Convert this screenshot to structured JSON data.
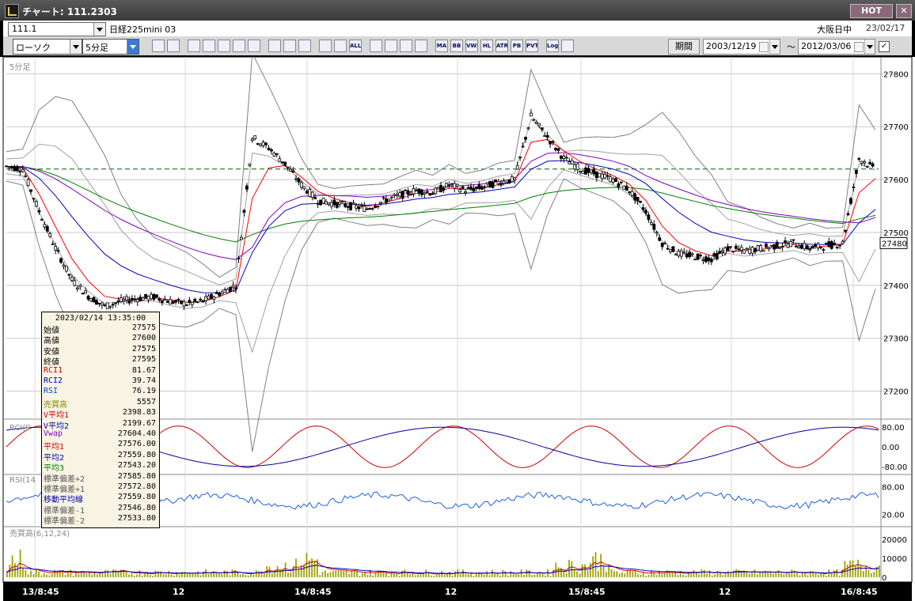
{
  "window": {
    "title": "チャート: 111.2303",
    "hot_label": "HOT",
    "close_label": "✕"
  },
  "header": {
    "code": "111.1",
    "instrument": "日経225mini 03",
    "session": "大阪日中",
    "date": "23/02/17"
  },
  "toolbar": {
    "chart_type": "ローソク",
    "interval": "5分足",
    "icons": [
      "zoom-icon",
      "crosshair-icon",
      "mark-icon",
      "search-icon",
      "image-icon",
      "compare-icon",
      "info-icon",
      "pen-icon",
      "cursor-icon",
      "undo-icon",
      "bar-icon",
      "bar2-icon",
      "all-icon",
      "gear-icon",
      "tools-icon",
      "color-icon",
      "indicator-icon",
      "ma-icon",
      "bb-icon",
      "vwap-icon",
      "hl-icon",
      "atr-icon",
      "pbr-icon",
      "pvt-icon",
      "log-icon",
      "export-icon"
    ],
    "ma_label": "MA",
    "bb_label": "BB",
    "vwap_label": "VWP",
    "hl_label": "HL",
    "atr_label": "ATR",
    "pb_label": "PB",
    "pvt_label": "PVT",
    "all_label": "ALL",
    "log_label": "Log",
    "period_label": "期間",
    "date_from": "2003/12/19",
    "date_to": "2012/03/06",
    "tilde": "～",
    "check": "✓"
  },
  "main_panel": {
    "label": "5分足",
    "yticks": [
      "27800",
      "27700",
      "27600",
      "27500",
      "27400",
      "27300",
      "27200"
    ],
    "current_price": "27480",
    "colors": {
      "bg": "#ffffff",
      "candle": "#000000",
      "bb": "#808080",
      "ma1": "#ff0000",
      "ma2": "#0000c0",
      "vwap": "#8000c0",
      "ma3": "#008000",
      "dashed": "#006000"
    }
  },
  "rci_panel": {
    "label": "RCI(9",
    "yticks": [
      "80.00",
      "0.00",
      "-80.00"
    ]
  },
  "rsi_panel": {
    "label": "RSI(14",
    "yticks": [
      "80.00",
      "20.00"
    ]
  },
  "volume_panel": {
    "label": "売買高(6,12,24)",
    "yticks": [
      "20000",
      "10000",
      "0"
    ]
  },
  "xaxis": {
    "ticks": [
      "13/8:45",
      "12",
      "14/8:45",
      "12",
      "15/8:45",
      "12",
      "16/8:45"
    ]
  },
  "tooltip": {
    "datetime": "2023/02/14 13:35:00",
    "rows": [
      {
        "label": "始値",
        "value": "27575",
        "color": "#000000"
      },
      {
        "label": "高値",
        "value": "27600",
        "color": "#000000"
      },
      {
        "label": "安値",
        "value": "27575",
        "color": "#000000"
      },
      {
        "label": "終値",
        "value": "27595",
        "color": "#000000"
      },
      {
        "label": "RCI1",
        "value": "81.67",
        "color": "#cc0000"
      },
      {
        "label": "RCI2",
        "value": "39.74",
        "color": "#0000aa"
      },
      {
        "label": "RSI",
        "value": "76.19",
        "color": "#0044cc"
      },
      {
        "label": "売買高",
        "value": "5557",
        "color": "#888800"
      },
      {
        "label": "V平均1",
        "value": "2398.83",
        "color": "#cc0000"
      },
      {
        "label": "V平均2",
        "value": "2199.67",
        "color": "#0000aa"
      },
      {
        "label": "Vwap",
        "value": "27604.40",
        "color": "#8000c0"
      },
      {
        "label": "平均1",
        "value": "27576.00",
        "color": "#cc0000"
      },
      {
        "label": "平均2",
        "value": "27559.80",
        "color": "#0000aa"
      },
      {
        "label": "平均3",
        "value": "27543.20",
        "color": "#008000"
      },
      {
        "label": "標準偏差+2",
        "value": "27585.80",
        "color": "#555555"
      },
      {
        "label": "標準偏差+1",
        "value": "27572.80",
        "color": "#555555"
      },
      {
        "label": "移動平均線",
        "value": "27559.80",
        "color": "#0000aa"
      },
      {
        "label": "標準偏差-1",
        "value": "27546.80",
        "color": "#555555"
      },
      {
        "label": "標準偏差-2",
        "value": "27533.80",
        "color": "#555555"
      }
    ]
  },
  "chart_data": {
    "type": "line",
    "title": "",
    "xlabel": "",
    "ylabel": "",
    "x": [
      "13/8:45",
      "12",
      "14/8:45",
      "12",
      "15/8:45",
      "12",
      "16/8:45"
    ],
    "ylim": [
      27150,
      27820
    ],
    "reference_level": 27620,
    "series": [
      {
        "values": [
          27625,
          27620,
          27540,
          27470,
          27410,
          27380,
          27360,
          27370,
          27375,
          27378,
          27370,
          27365,
          27370,
          27385,
          27400,
          27680,
          27660,
          27630,
          27590,
          27560,
          27555,
          27550,
          27545,
          27560,
          27570,
          27580,
          27575,
          27590,
          27580,
          27585,
          27595,
          27600,
          27720,
          27680,
          27640,
          27620,
          27610,
          27600,
          27580,
          27540,
          27480,
          27460,
          27455,
          27450,
          27470,
          27465,
          27470,
          27475,
          27480,
          27470,
          27475,
          27480,
          27640,
          27620
        ]
      }
    ]
  }
}
